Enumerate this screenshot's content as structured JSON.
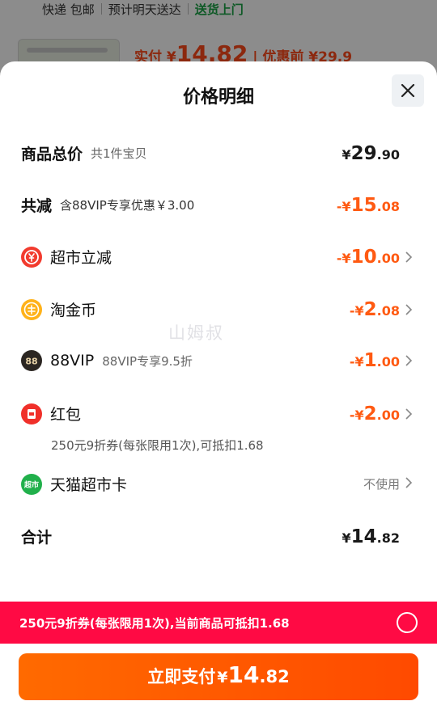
{
  "background": {
    "shipping": "快递 包邮",
    "eta": "预计明天送达",
    "delivery_tag": "送货上门",
    "pay_prefix": "实付",
    "pay_currency": "¥",
    "pay_amount": "14.82",
    "before_discount": "| 优惠前 ¥29.9"
  },
  "sheet": {
    "title": "价格明细",
    "watermark": "山姆叔",
    "rows": [
      {
        "label": "商品总价",
        "sub": "共1件宝贝",
        "currency": "¥",
        "main": "29",
        "dec": ".90"
      },
      {
        "label": "共减",
        "sub": "含88VIP专享优惠￥3.00",
        "currency": "-¥",
        "main": "15",
        "dec": ".08"
      },
      {
        "label": "超市立减",
        "currency": "-¥",
        "main": "10",
        "dec": ".00",
        "icon": "supermarket-discount-icon"
      },
      {
        "label": "淘金币",
        "currency": "-¥",
        "main": "2",
        "dec": ".08",
        "icon": "taojinbi-coin-icon"
      },
      {
        "label": "88VIP",
        "sub": "88VIP专享9.5折",
        "currency": "-¥",
        "main": "1",
        "dec": ".00",
        "icon": "88vip-icon"
      },
      {
        "label": "红包",
        "currency": "-¥",
        "main": "2",
        "dec": ".00",
        "icon": "red-packet-icon"
      },
      {
        "label": "天猫超市卡",
        "link": "不使用",
        "icon": "tmall-card-icon"
      },
      {
        "label": "合计",
        "currency": "¥",
        "main": "14",
        "dec": ".82"
      }
    ],
    "red_packet_note": "250元9折券(每张限用1次),可抵扣1.68"
  },
  "promo": {
    "text": "250元9折券(每张限用1次),当前商品可抵扣1.68"
  },
  "pay_button": {
    "label": "立即支付",
    "currency": "¥",
    "main": "14",
    "dec": ".82"
  },
  "colors": {
    "accent_orange": "#ff5a12",
    "promo_red": "#ff0a44",
    "green": "#1aa345"
  }
}
